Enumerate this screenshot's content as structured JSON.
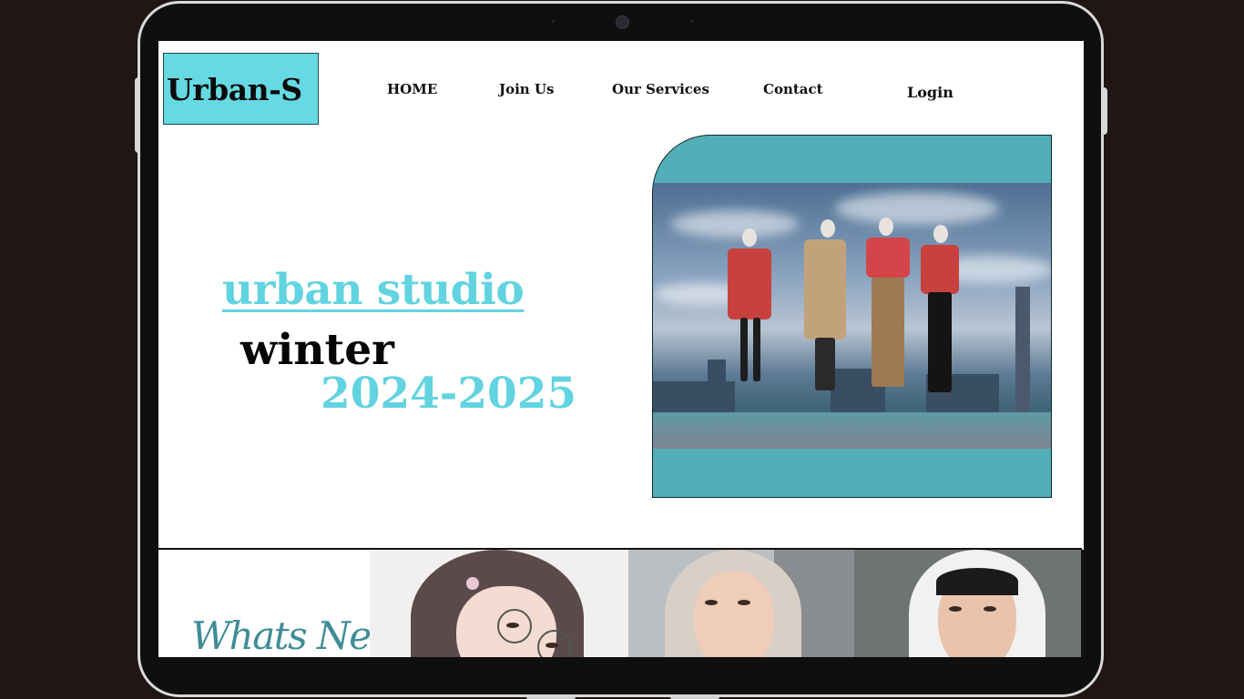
{
  "brand": {
    "logo_text": "Urban-S",
    "accent_color": "#66d9e3"
  },
  "nav": {
    "home": "HOME",
    "join": "Join Us",
    "services": "Our Services",
    "contact": "Contact",
    "login": "Login"
  },
  "hero": {
    "title": "urban studio",
    "season": "winter",
    "years": "2024-2025",
    "image": "fashion mannequins in city skyline"
  },
  "whats_new": {
    "title": "Whats New",
    "images": [
      "hijab illustration with glasses",
      "woman in beige hijab",
      "woman in white hijab"
    ]
  },
  "colors": {
    "frame_teal": "#54aeb8",
    "title_teal": "#62d3e0",
    "whats_new_teal": "#3f8c96",
    "device_bezel": "#0f0f0f",
    "background": "#1f1615"
  }
}
